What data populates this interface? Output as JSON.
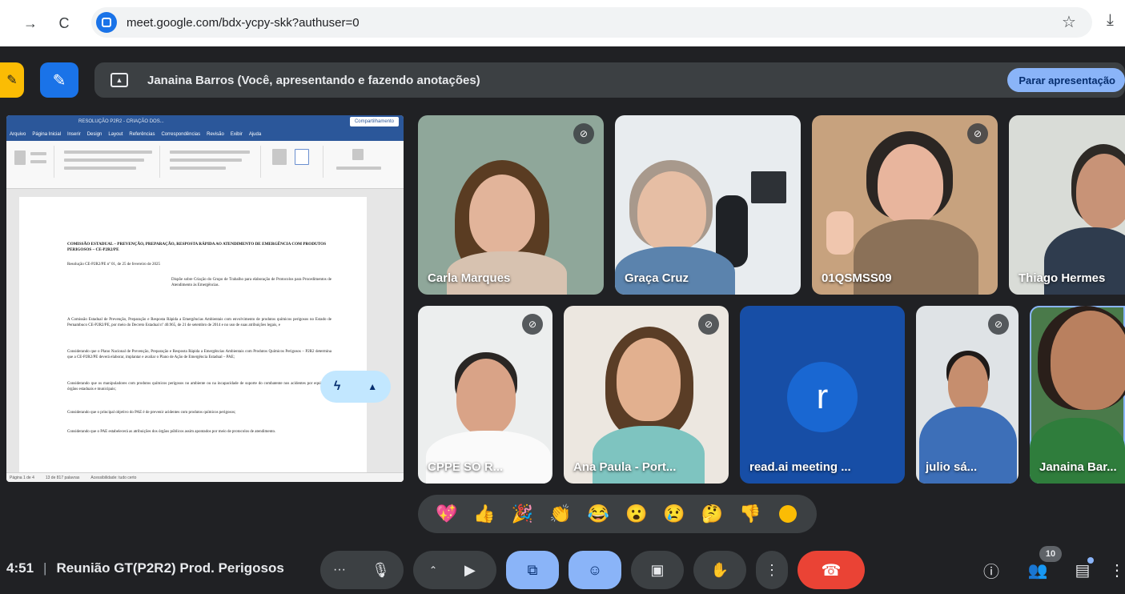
{
  "browser": {
    "url": "meet.google.com/bdx-ycpy-skk?authuser=0"
  },
  "presentation": {
    "banner_text": "Janaina Barros (Você, apresentando e fazendo anotações)",
    "stop_label": "Parar apresentação"
  },
  "document": {
    "window_title": "RESOLUÇÃO P2R2 - CRIAÇÃO DOS...",
    "share_label": "Compartilhamento",
    "tabs": [
      "Arquivo",
      "Página Inicial",
      "Inserir",
      "Design",
      "Layout",
      "Referências",
      "Correspondências",
      "Revisão",
      "Exibir",
      "Ajuda"
    ],
    "heading": "COMISSÃO ESTADUAL – PREVENÇÃO, PREPARAÇÃO, RESPOSTA RÁPIDA AO ATENDIMENTO DE EMERGÊNCIA COM PRODUTOS PERIGOSOS – CE-P2R2/PE",
    "resolution_line": "Resolução CE-P2R2/PE nº 01, de 25 de fevereiro de 2025",
    "ementa": "Dispõe sobre Criação do Grupo de Trabalho para elaboração de Protocolos para Procedimentos de Atendimento às Emergências.",
    "paragraphs": [
      "A Comissão Estadual de Prevenção, Preparação e Resposta Rápida a Emergências Ambientais com envolvimento de produtos químicos perigosos no Estado de Pernambuco CE-P2R2/PE, por meio do Decreto Estadual nº 40.965, de 21 de setembro de 2014 e no uso de suas atribuições legais, e",
      "Considerando que o Plano Nacional de Prevenção, Preparação e Resposta Rápida a Emergências Ambientais com Produtos Químicos Perigosos – P2R2 determina que a CE-P2R2/PE deverá elaborar, implantar e avaliar o Plano de Ação de Emergência Estadual – PAE;",
      "Considerando que os manipuladores com produtos químicos perigosos no ambiente ou na incapacidade de suporte do combatente nos acidentes por equipes de órgãos estaduais e municipais;",
      "Considerando que o principal objetivo do PAE é de prevenir acidentes com produtos químicos perigosos;",
      "Considerando que o PAE estabelecerá as atribuições dos órgãos públicos assim apontados por meio de protocolos de atendimento."
    ],
    "status_items": [
      "Página 1 de 4",
      "13 de 817 palavras",
      "Acessibilidade: tudo certo"
    ]
  },
  "participants": [
    {
      "name": "Carla Marques",
      "muted": true
    },
    {
      "name": "Graça Cruz",
      "muted": false
    },
    {
      "name": "01QSMSS09",
      "muted": true
    },
    {
      "name": "Thiago Hermes",
      "muted": false
    },
    {
      "name": "CPPE SO R...",
      "muted": true
    },
    {
      "name": "Ana Paula - Port...",
      "muted": true
    },
    {
      "name": "read.ai meeting ...",
      "muted": false,
      "avatar_letter": "r"
    },
    {
      "name": "julio sá...",
      "muted": true
    },
    {
      "name": "Janaina Bar...",
      "muted": false
    }
  ],
  "reactions": [
    "💖",
    "👍",
    "🎉",
    "👏",
    "😂",
    "😮",
    "😢",
    "🤔",
    "👎"
  ],
  "controls": {
    "time": "4:51",
    "meeting_title": "Reunião GT(P2R2) Prod. Perigosos",
    "people_count": "10"
  },
  "icons": {
    "forward": "arrow-right-icon",
    "reload": "reload-icon",
    "star": "star-icon",
    "download": "download-icon",
    "mic": "mic-icon",
    "camera": "camera-icon",
    "present": "present-icon",
    "emoji": "emoji-icon",
    "captions": "captions-icon",
    "hand": "raise-hand-icon",
    "more": "more-vert-icon",
    "hangup": "hangup-icon",
    "info": "info-icon",
    "people": "people-icon",
    "chat": "chat-icon"
  },
  "colors": {
    "meet_bg": "#202124",
    "accent_blue": "#8ab4f8",
    "hangup_red": "#ea4335",
    "word_blue": "#2b579a"
  }
}
